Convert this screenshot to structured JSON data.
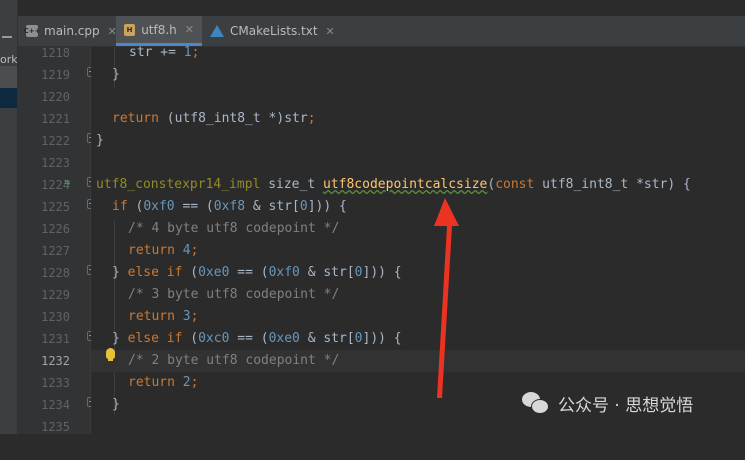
{
  "project_strip": {
    "label": "ork"
  },
  "tabs": [
    {
      "label": "main.cpp",
      "icon": "cpp-file-icon",
      "active": false
    },
    {
      "label": "utf8.h",
      "icon": "header-file-icon",
      "active": true
    },
    {
      "label": "CMakeLists.txt",
      "icon": "cmake-file-icon",
      "active": false
    }
  ],
  "close_glyph": "✕",
  "line_numbers": [
    "1218",
    "1219",
    "1220",
    "1221",
    "1222",
    "1223",
    "1224",
    "1225",
    "1226",
    "1227",
    "1228",
    "1229",
    "1230",
    "1231",
    "1232",
    "1233",
    "1234",
    "1235"
  ],
  "current_line": "1232",
  "code": {
    "l1218": {
      "a": "str += ",
      "b": "1",
      "c": ";"
    },
    "l1219": "}",
    "l1221": {
      "kw": "return",
      "rest": " (utf8_int8_t *)str",
      "semi": ";"
    },
    "l1222": "}",
    "l1224": {
      "macro": "utf8_constexpr14_impl",
      "type": " size_t ",
      "fn": "utf8codepointcalcsize",
      "open": "(",
      "kw": "const",
      "params": " utf8_int8_t *str) {"
    },
    "l1225": {
      "kw": "if",
      "p1": " (",
      "n1": "0xf0",
      "p2": " == (",
      "n2": "0xf8",
      "p3": " & str[",
      "n3": "0",
      "p4": "])) {"
    },
    "l1226": "/* 4 byte utf8 codepoint */",
    "l1227": {
      "kw": "return",
      "sp": " ",
      "n": "4",
      "semi": ";"
    },
    "l1228": {
      "a": "} ",
      "kw1": "else",
      "sp": " ",
      "kw2": "if",
      "p1": " (",
      "n1": "0xe0",
      "p2": " == (",
      "n2": "0xf0",
      "p3": " & str[",
      "n3": "0",
      "p4": "])) {"
    },
    "l1229": "/* 3 byte utf8 codepoint */",
    "l1230": {
      "kw": "return",
      "sp": " ",
      "n": "3",
      "semi": ";"
    },
    "l1231": {
      "a": "} ",
      "kw1": "else",
      "sp": " ",
      "kw2": "if",
      "p1": " (",
      "n1": "0xc0",
      "p2": " == (",
      "n2": "0xe0",
      "p3": " & str[",
      "n3": "0",
      "p4": "])) {"
    },
    "l1232": "/* 2 byte utf8 codepoint */",
    "l1233": {
      "kw": "return",
      "sp": " ",
      "n": "2",
      "semi": ";"
    },
    "l1234": "}"
  },
  "watermark": {
    "text": "公众号 · 思想觉悟"
  },
  "colors": {
    "keyword": "#cc7832",
    "number": "#6897bb",
    "comment": "#808080",
    "function": "#ffc66d",
    "macro": "#908b25",
    "arrow": "#ea3323",
    "tab_accent": "#4a88c7"
  }
}
